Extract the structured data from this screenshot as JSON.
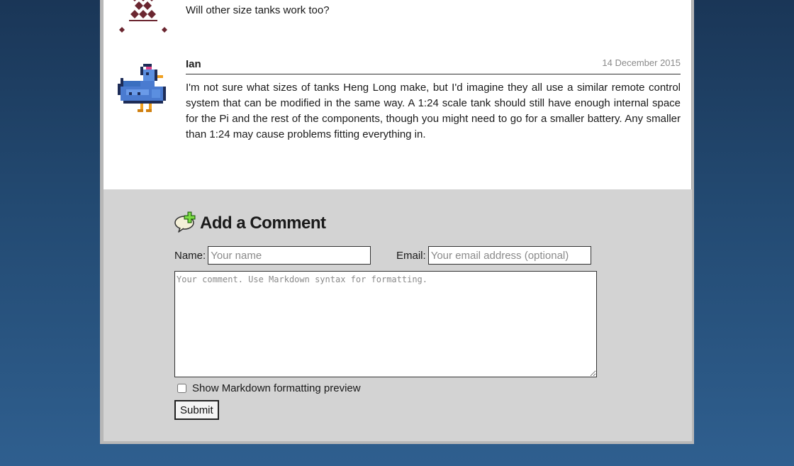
{
  "comments": [
    {
      "author": "",
      "date": "",
      "text": "Will other size tanks work too?",
      "avatar_icon": "quilt-pattern-avatar"
    },
    {
      "author": "Ian",
      "date": "14 December 2015",
      "text": "I'm not sure what sizes of tanks Heng Long make, but I'd imagine they all use a similar remote control system that can be modified in the same way. A 1:24 scale tank should still have enough internal space for the Pi and the rest of the components, though you might need to go for a smaller battery. Any smaller than 1:24 may cause problems fitting everything in.",
      "avatar_icon": "pixel-chicken-avatar"
    }
  ],
  "add_comment": {
    "title": "Add a Comment",
    "icon": "add-comment-icon",
    "name_label": "Name:",
    "name_placeholder": "Your name",
    "email_label": "Email:",
    "email_placeholder": "Your email address (optional)",
    "comment_placeholder": "Your comment. Use Markdown syntax for formatting.",
    "preview_label": "Show Markdown formatting preview",
    "submit_label": "Submit"
  },
  "colors": {
    "page_bg_top": "#1a3657",
    "page_bg_bottom": "#2f5f8f",
    "form_bg": "#d3d3d3",
    "avatar_maroon": "#6b2630",
    "chicken_blue": "#3a6fc0"
  }
}
